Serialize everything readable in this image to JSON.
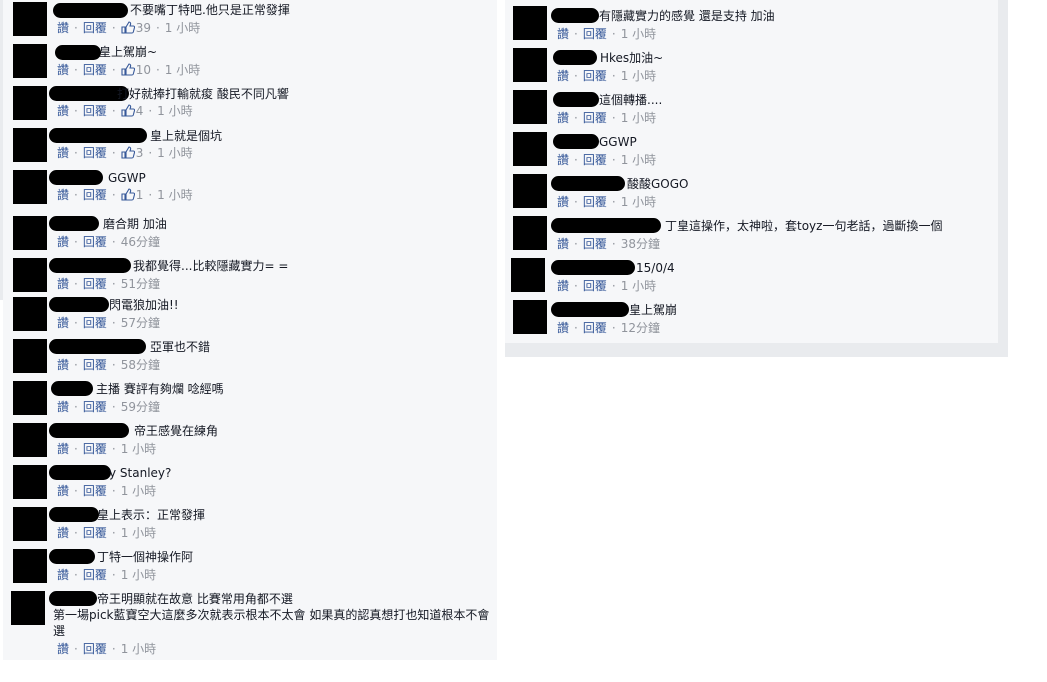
{
  "actions": {
    "like": "讚",
    "reply": "回覆",
    "dot": "·"
  },
  "left_comments": [
    {
      "text": "不要嘴丁特吧.他只是正常發揮",
      "likes": "39",
      "time": "1 小時"
    },
    {
      "text": "皇上駕崩~",
      "likes": "10",
      "time": "1 小時"
    },
    {
      "text": "打好就捧打輸就痠 酸民不同凡響",
      "likes": "4",
      "time": "1 小時"
    },
    {
      "text": "皇上就是個坑",
      "likes": "3",
      "time": "1 小時"
    },
    {
      "text": "GGWP",
      "likes": "1",
      "time": "1 小時"
    },
    {
      "text": "磨合期 加油",
      "likes": "",
      "time": "46分鐘"
    },
    {
      "text": "我都覺得...比較隱藏實力= =",
      "likes": "",
      "time": "51分鐘"
    },
    {
      "text": "閃電狼加油!!",
      "likes": "",
      "time": "57分鐘"
    },
    {
      "text": "亞軍也不錯",
      "likes": "",
      "time": "58分鐘"
    },
    {
      "text": "主播 賽評有夠爛 唸經嗎",
      "likes": "",
      "time": "59分鐘"
    },
    {
      "text": "帝王感覺在練角",
      "likes": "",
      "time": "1 小時"
    },
    {
      "text": "y Stanley?",
      "likes": "",
      "time": "1 小時"
    },
    {
      "text": "皇上表示：正常發揮",
      "likes": "",
      "time": "1 小時"
    },
    {
      "text": "丁特一個神操作阿",
      "likes": "",
      "time": "1 小時"
    },
    {
      "text": "帝王明顯就在故意 比賽常用角都不選",
      "text2": "第一場pick藍寶空大這麼多次就表示根本不太會 如果真的認真想打也知道根本不會選",
      "likes": "",
      "time": "1 小時"
    }
  ],
  "right_comments": [
    {
      "text": "有隱藏實力的感覺 還是支持 加油",
      "likes": "",
      "time": "1 小時"
    },
    {
      "text": "Hkes加油~",
      "likes": "",
      "time": "1 小時"
    },
    {
      "text": "這個轉播....",
      "likes": "",
      "time": "1 小時"
    },
    {
      "text": "GGWP",
      "likes": "",
      "time": "1 小時"
    },
    {
      "text": "酸酸GOGO",
      "likes": "",
      "time": "1 小時"
    },
    {
      "text": "丁皇這操作，太神啦，套toyz一句老話，過斷換一個",
      "likes": "",
      "time": "38分鐘"
    },
    {
      "text": "15/0/4",
      "likes": "",
      "time": "1 小時"
    },
    {
      "text": "皇上駕崩",
      "likes": "",
      "time": "12分鐘"
    }
  ]
}
